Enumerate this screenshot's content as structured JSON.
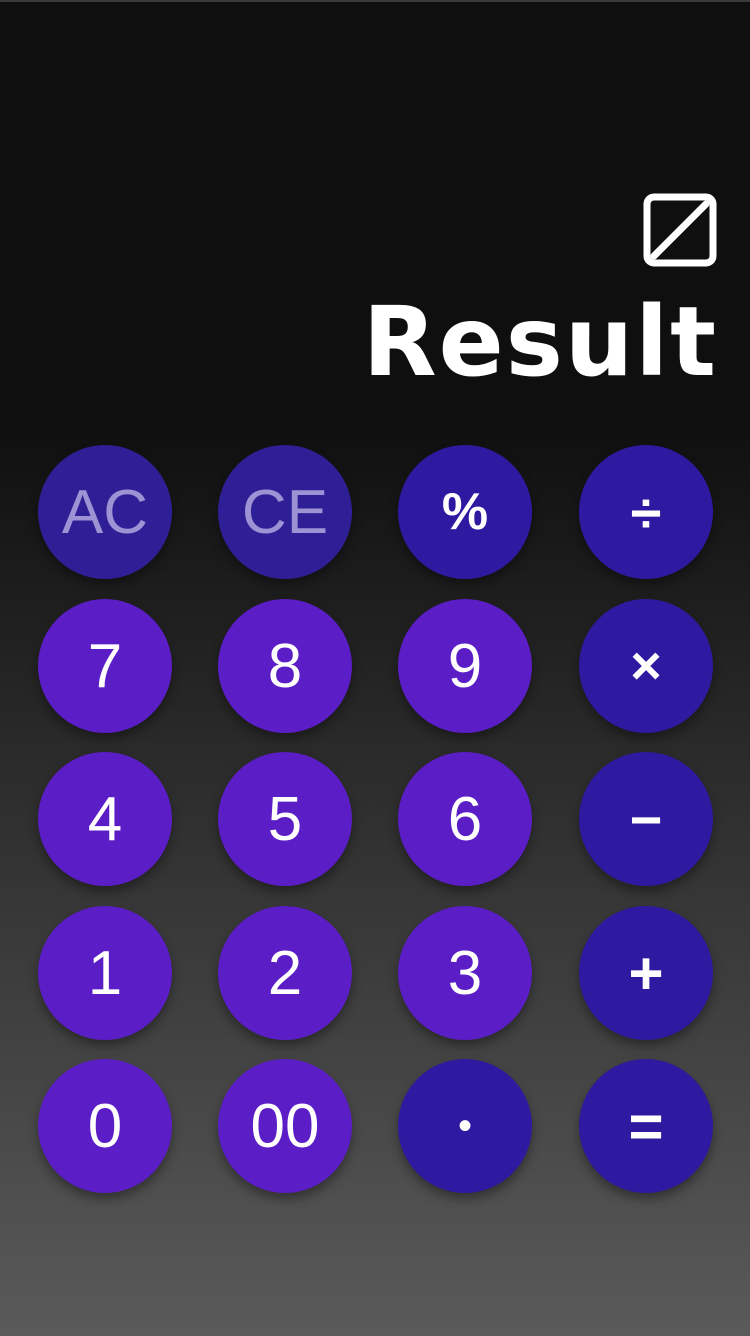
{
  "display": {
    "result_text": "Result",
    "toggle_icon": "slash-square-icon"
  },
  "colors": {
    "number_key": "#5b1dc6",
    "operator_key": "#2e19a1",
    "clear_key": "#2f1f96",
    "clear_text": "#9d93d4",
    "text": "#ffffff"
  },
  "keypad": {
    "ac": "AC",
    "ce": "CE",
    "percent": "%",
    "divide": "÷",
    "multiply": "×",
    "minus": "−",
    "plus": "+",
    "equals": "=",
    "dot": "•",
    "seven": "7",
    "eight": "8",
    "nine": "9",
    "four": "4",
    "five": "5",
    "six": "6",
    "one": "1",
    "two": "2",
    "three": "3",
    "zero": "0",
    "double_zero": "00"
  }
}
